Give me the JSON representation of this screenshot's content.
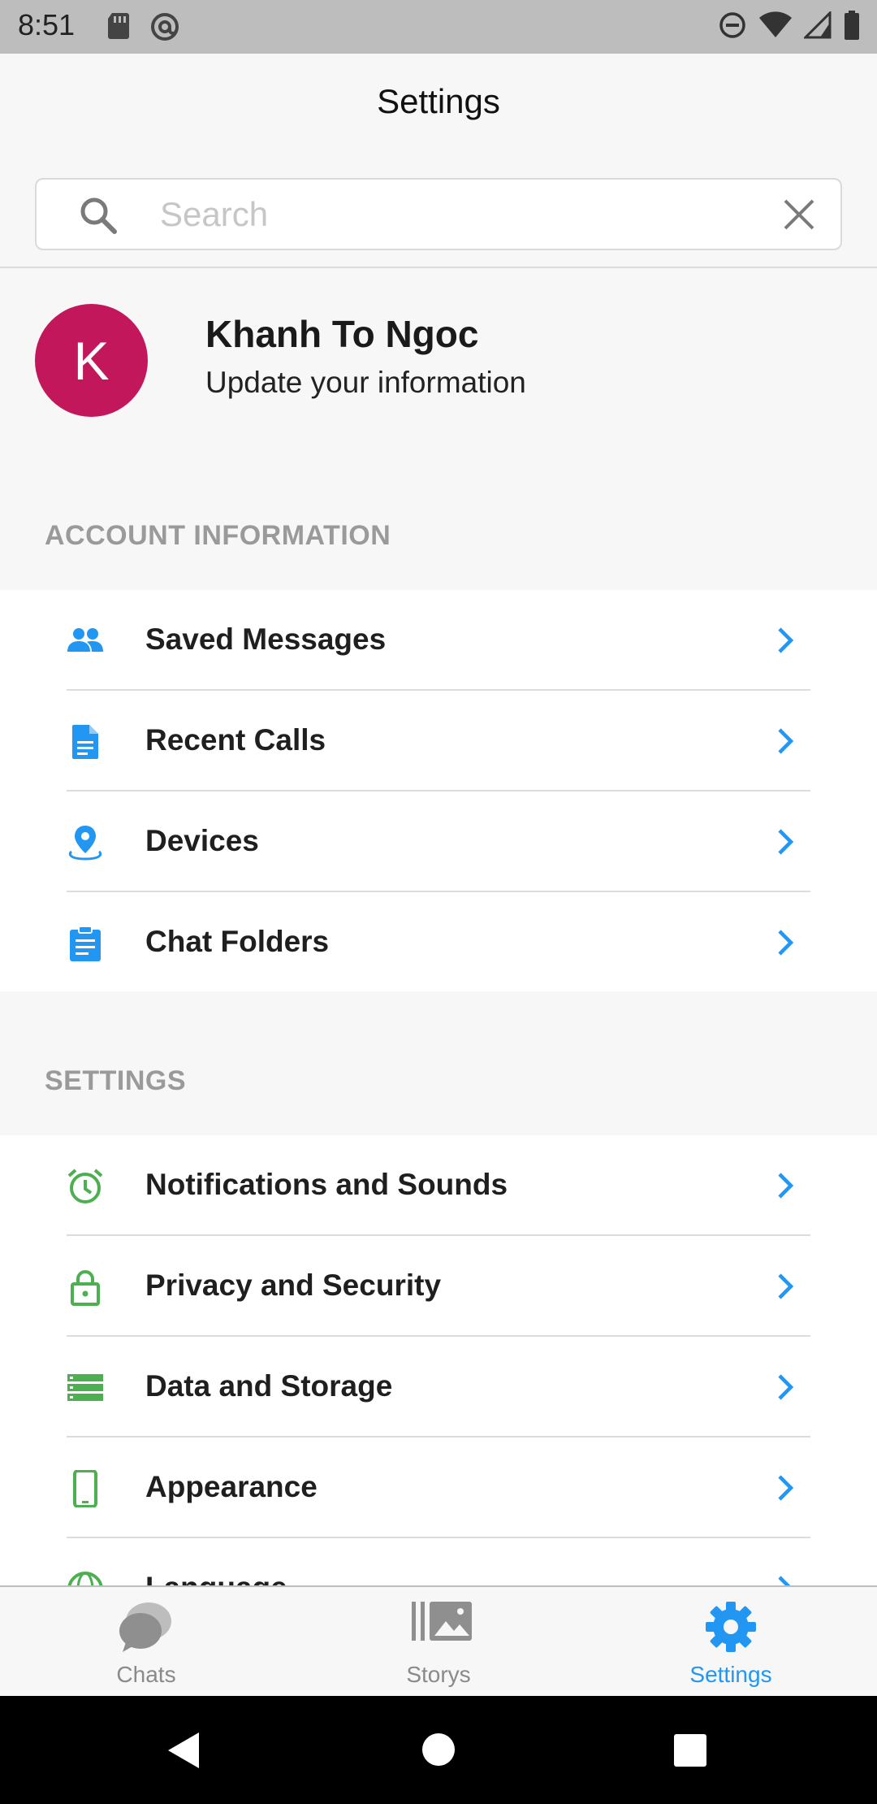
{
  "status_bar": {
    "time": "8:51",
    "left_icons": [
      "sd-card-icon",
      "at-sign-icon"
    ],
    "right_icons": [
      "do-not-disturb-icon",
      "wifi-icon",
      "signal-icon",
      "battery-icon"
    ]
  },
  "header": {
    "title": "Settings"
  },
  "search": {
    "placeholder": "Search",
    "value": ""
  },
  "profile": {
    "avatar_initial": "K",
    "avatar_color": "#c2185b",
    "name": "Khanh To Ngoc",
    "subtitle": "Update your information"
  },
  "account_section": {
    "title": "ACCOUNT INFORMATION",
    "items": [
      {
        "label": "Saved Messages",
        "icon": "people-icon",
        "icon_color": "#2196f3"
      },
      {
        "label": "Recent Calls",
        "icon": "document-icon",
        "icon_color": "#2196f3"
      },
      {
        "label": "Devices",
        "icon": "location-pin-icon",
        "icon_color": "#2196f3"
      },
      {
        "label": "Chat Folders",
        "icon": "clipboard-icon",
        "icon_color": "#2196f3"
      }
    ]
  },
  "settings_section": {
    "title": "SETTINGS",
    "items": [
      {
        "label": "Notifications and Sounds",
        "icon": "alarm-clock-icon",
        "icon_color": "#4caf50"
      },
      {
        "label": "Privacy and Security",
        "icon": "lock-icon",
        "icon_color": "#4caf50"
      },
      {
        "label": "Data and Storage",
        "icon": "storage-icon",
        "icon_color": "#4caf50"
      },
      {
        "label": "Appearance",
        "icon": "phone-icon",
        "icon_color": "#4caf50"
      },
      {
        "label": "Language",
        "icon": "globe-icon",
        "icon_color": "#4caf50"
      }
    ]
  },
  "bottom_nav": {
    "items": [
      {
        "label": "Chats",
        "icon": "chat-bubbles-icon",
        "active": false
      },
      {
        "label": "Storys",
        "icon": "gallery-icon",
        "active": false
      },
      {
        "label": "Settings",
        "icon": "gear-icon",
        "active": true
      }
    ]
  },
  "colors": {
    "accent": "#2196f3",
    "settings_icon_green": "#4caf50",
    "section_header_gray": "#9a9a9a"
  }
}
